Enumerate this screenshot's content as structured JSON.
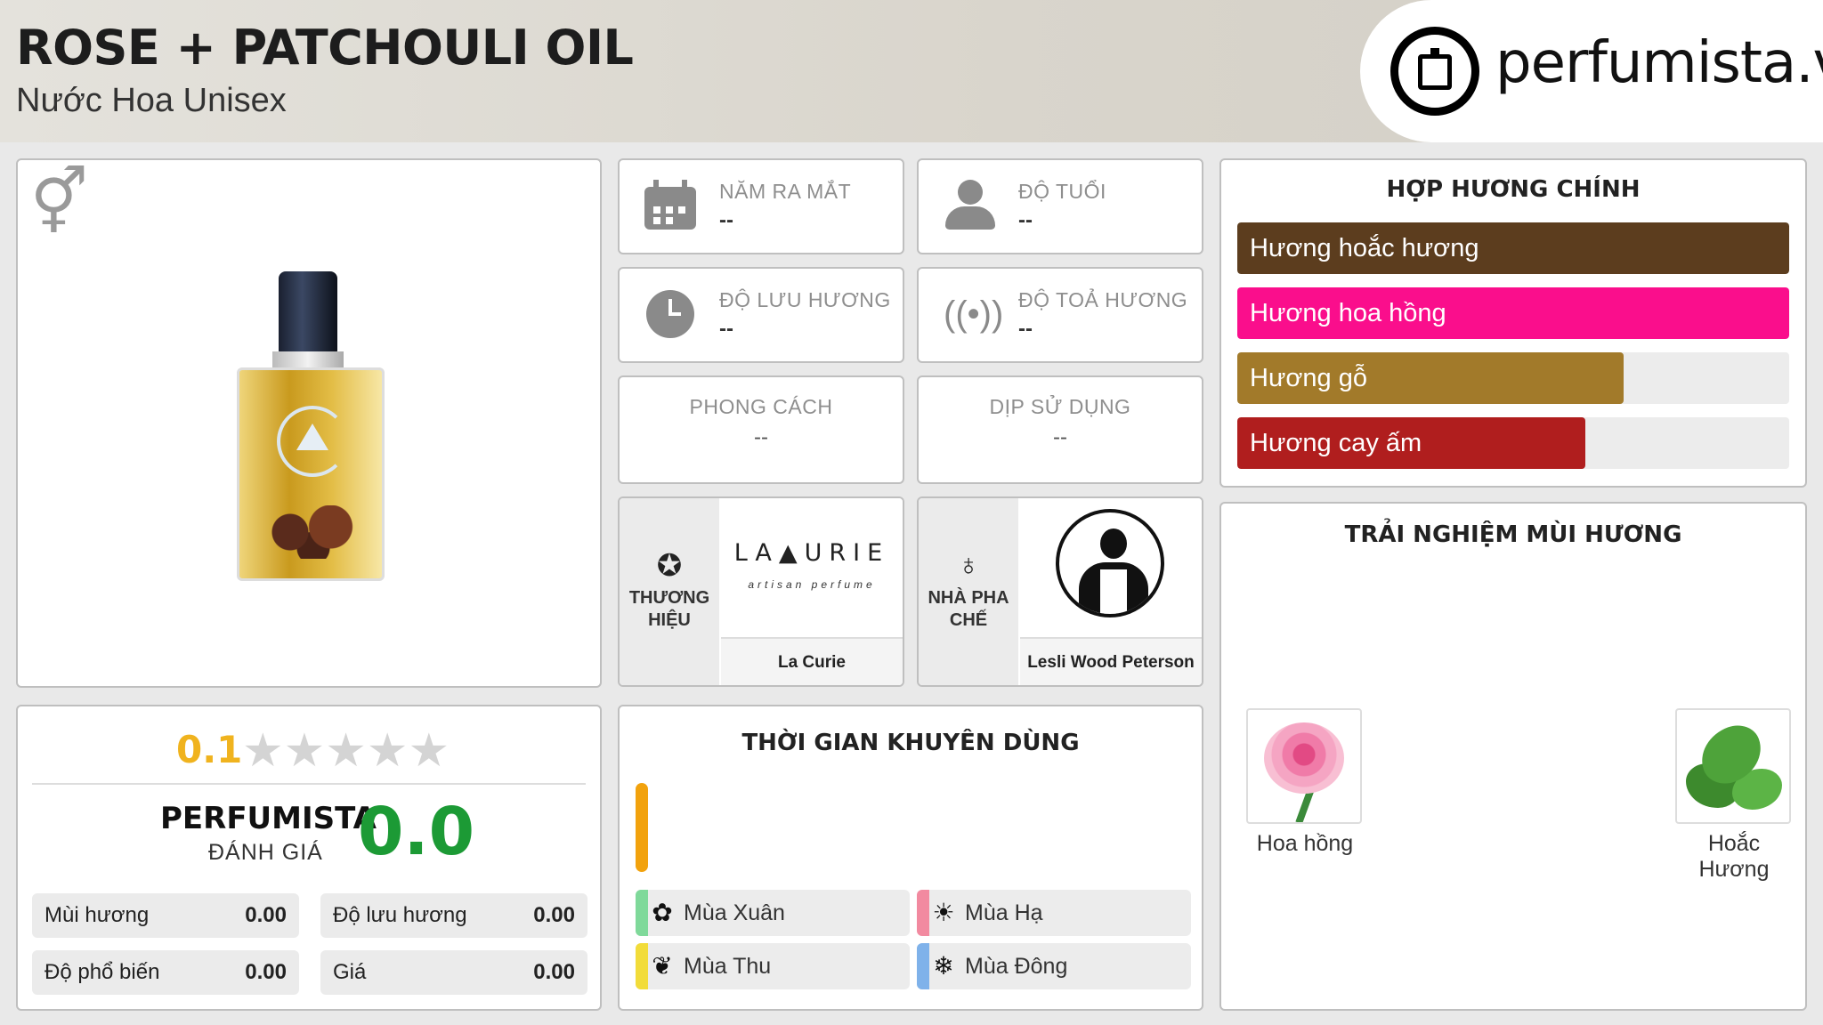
{
  "header": {
    "title": "ROSE + PATCHOULI OIL",
    "subtitle": "Nước Hoa Unisex",
    "logo_text": "perfumista.vn"
  },
  "product": {
    "gender_icon": "male-female-icon"
  },
  "info": {
    "launch_year": {
      "label": "NĂM RA MẮT",
      "value": "--",
      "icon": "calendar-icon"
    },
    "age": {
      "label": "ĐỘ TUỔI",
      "value": "--",
      "icon": "person-icon"
    },
    "longevity": {
      "label": "ĐỘ LƯU HƯƠNG",
      "value": "--",
      "icon": "clock-icon"
    },
    "sillage": {
      "label": "ĐỘ TOẢ HƯƠNG",
      "value": "--",
      "icon": "sillage-icon"
    },
    "style": {
      "label": "PHONG CÁCH",
      "value": "--"
    },
    "occasion": {
      "label": "DỊP SỬ DỤNG",
      "value": "--"
    }
  },
  "brand": {
    "caption": "THƯƠNG HIỆU",
    "name": "La Curie",
    "logo_main": "LA▲URIE",
    "logo_sub": "artisan perfume",
    "icon": "star-badge-icon"
  },
  "perfumer": {
    "caption": "NHÀ PHA CHẾ",
    "name": "Lesli Wood Peterson",
    "icon": "nose-icon"
  },
  "notes": {
    "title": "HỢP HƯƠNG CHÍNH",
    "items": [
      {
        "label": "Hương hoắc hương",
        "color": "#5c3d1e",
        "percent": 100
      },
      {
        "label": "Hương hoa hồng",
        "color": "#fa0e8c",
        "percent": 100
      },
      {
        "label": "Hương gỗ",
        "color": "#a27a2a",
        "percent": 70
      },
      {
        "label": "Hương cay ấm",
        "color": "#b01e1e",
        "percent": 63
      }
    ]
  },
  "experience": {
    "title": "TRẢI NGHIỆM MÙI HƯƠNG",
    "items": [
      {
        "name": "Hoa hồng"
      },
      {
        "name": "Hoắc Hương"
      }
    ]
  },
  "rating": {
    "user_score": "0.1",
    "stars": "★★★★★",
    "star_value": 0.1,
    "pf_label": "PERFUMISTA",
    "pf_sub": "ĐÁNH GIÁ",
    "pf_score": "0.0",
    "metrics": [
      {
        "label": "Mùi hương",
        "value": "0.00"
      },
      {
        "label": "Độ lưu hương",
        "value": "0.00"
      },
      {
        "label": "Độ phổ biến",
        "value": "0.00"
      },
      {
        "label": "Giá",
        "value": "0.00"
      }
    ]
  },
  "time": {
    "title": "THỜI GIAN KHUYÊN DÙNG",
    "bar_color": "#f2a20d",
    "seasons": [
      {
        "label": "Mùa Xuân",
        "icon": "flower-icon",
        "color": "#7fd99a"
      },
      {
        "label": "Mùa Hạ",
        "icon": "sun-icon",
        "color": "#f28aa0"
      },
      {
        "label": "Mùa Thu",
        "icon": "leaf-icon",
        "color": "#f2dc3a"
      },
      {
        "label": "Mùa Đông",
        "icon": "snowflake-icon",
        "color": "#7fb2ea"
      }
    ]
  }
}
